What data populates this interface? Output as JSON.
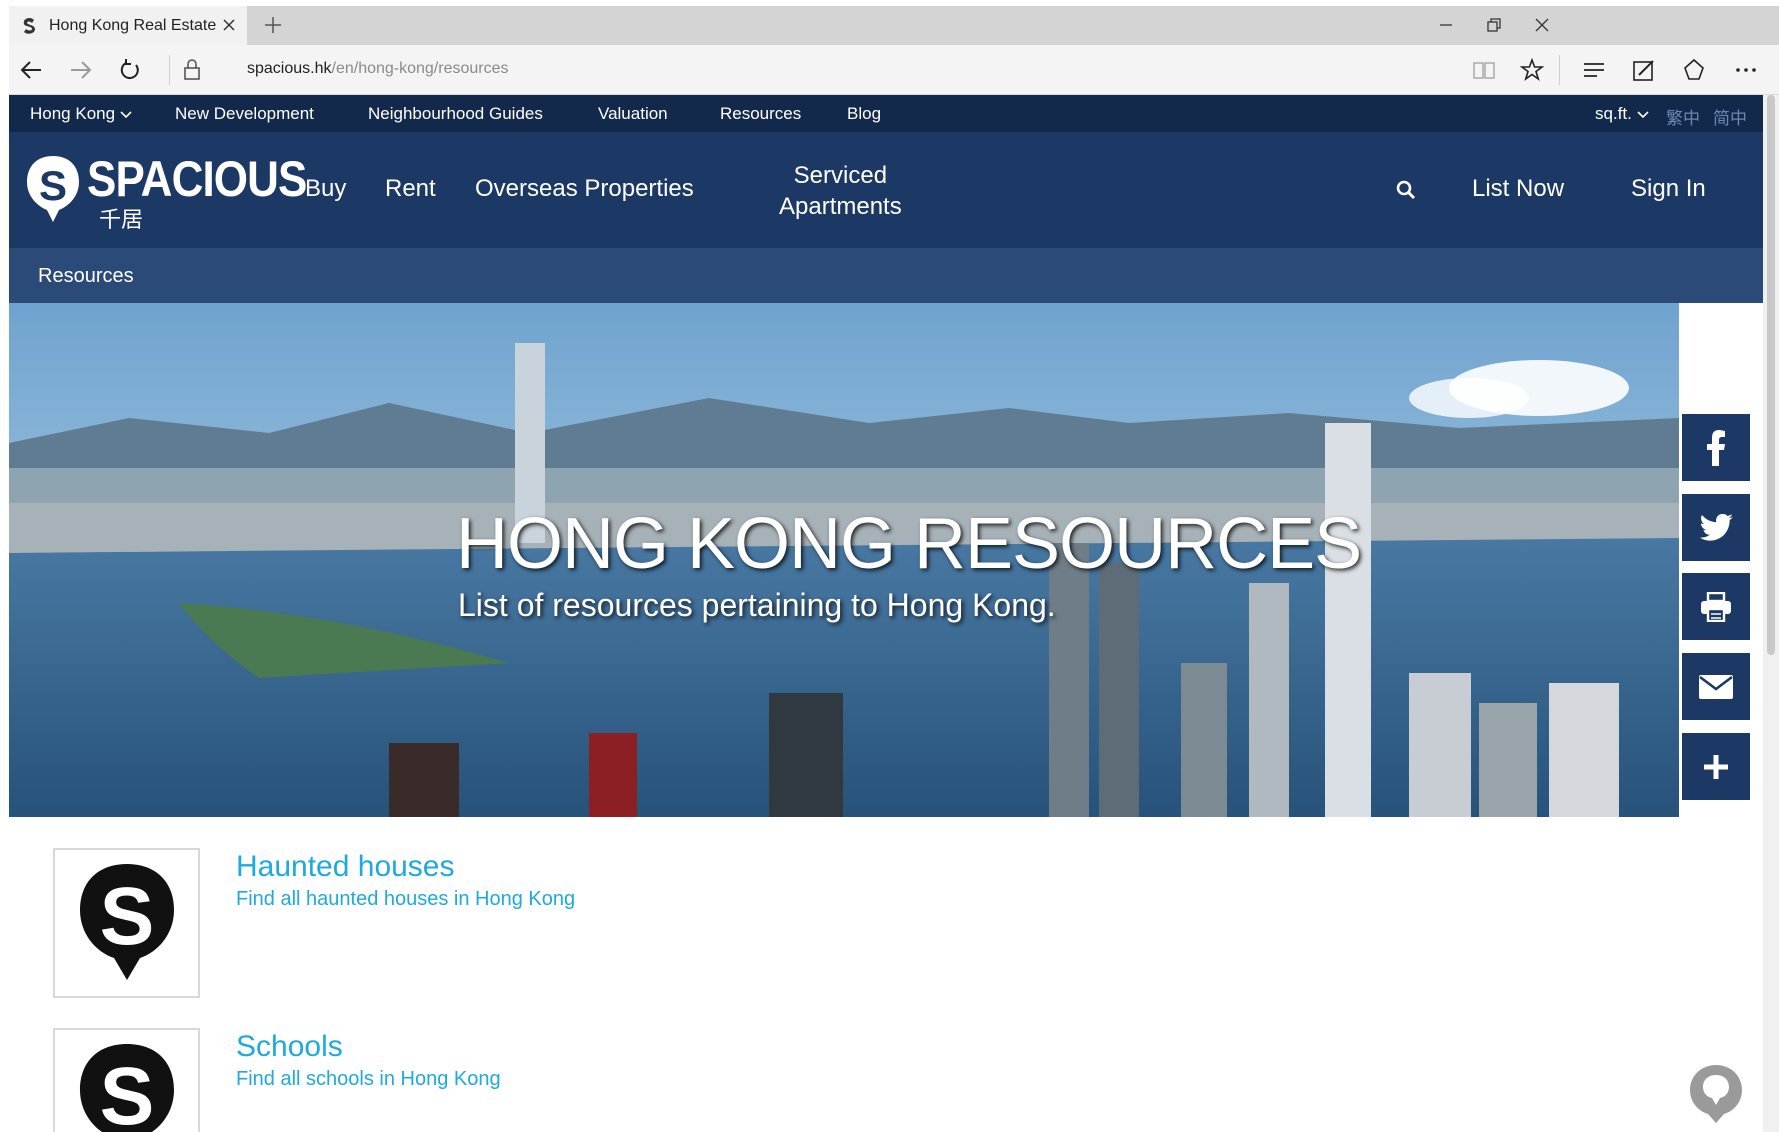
{
  "browser": {
    "tab_title": "Hong Kong Real Estate",
    "url_host": "spacious.hk",
    "url_path": "/en/hong-kong/resources"
  },
  "topnav": {
    "region": "Hong Kong",
    "items": [
      "New Development",
      "Neighbourhood Guides",
      "Valuation",
      "Resources",
      "Blog"
    ],
    "unit": "sq.ft.",
    "lang_traditional": "繁中",
    "lang_simplified": "简中"
  },
  "logo": {
    "brand": "SPACIOUS",
    "chinese": "千居"
  },
  "mainnav": {
    "buy": "Buy",
    "rent": "Rent",
    "overseas": "Overseas Properties",
    "serviced_line1": "Serviced",
    "serviced_line2": "Apartments",
    "list_now": "List Now",
    "sign_in": "Sign In"
  },
  "breadcrumb": "Resources",
  "hero": {
    "title": "HONG KONG RESOURCES",
    "subtitle": "List of resources pertaining to Hong Kong."
  },
  "share_buttons": [
    "facebook-icon",
    "twitter-icon",
    "print-icon",
    "email-icon",
    "plus-icon"
  ],
  "resources": [
    {
      "title": "Haunted houses",
      "description": "Find all haunted houses in Hong Kong"
    },
    {
      "title": "Schools",
      "description": "Find all schools in Hong Kong"
    }
  ],
  "colors": {
    "topnav": "#13294b",
    "mainnav": "#1c3864",
    "breadcrumb_bar": "#2b4a78",
    "link": "#1eaadd"
  }
}
